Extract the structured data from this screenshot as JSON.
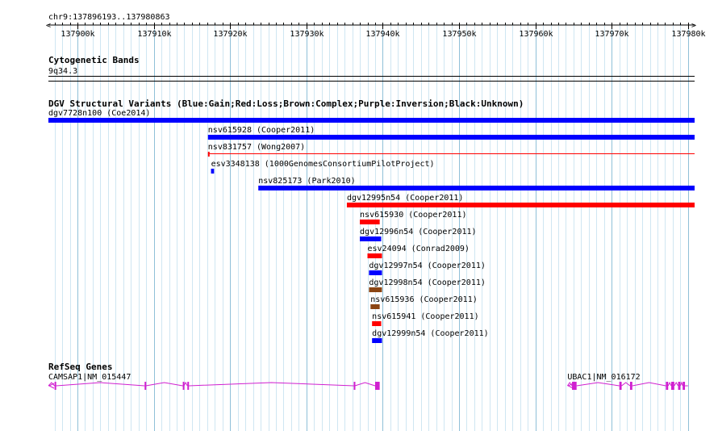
{
  "ruler": {
    "region": "chr9:137896193..137980863",
    "start": 137896193,
    "end": 137980863,
    "ticks": [
      {
        "pos": 137900000,
        "label": "137900k"
      },
      {
        "pos": 137910000,
        "label": "137910k"
      },
      {
        "pos": 137920000,
        "label": "137920k"
      },
      {
        "pos": 137930000,
        "label": "137930k"
      },
      {
        "pos": 137940000,
        "label": "137940k"
      },
      {
        "pos": 137950000,
        "label": "137950k"
      },
      {
        "pos": 137960000,
        "label": "137960k"
      },
      {
        "pos": 137970000,
        "label": "137970k"
      },
      {
        "pos": 137980000,
        "label": "137980k"
      }
    ]
  },
  "cytobands": {
    "title": "Cytogenetic Bands",
    "band": "9q34.3"
  },
  "dgv": {
    "title": "DGV Structural Variants (Blue:Gain;Red:Loss;Brown:Complex;Purple:Inversion;Black:Unknown)",
    "colors": {
      "gain": "#0000ff",
      "loss": "#ff0000",
      "complex": "#8b4513"
    },
    "variants": [
      {
        "label": "dgv7728n100 (Coe2014)",
        "start": 137896193,
        "end": 137980863,
        "type": "gain",
        "style": "bar"
      },
      {
        "label": "nsv615928 (Cooper2011)",
        "start": 137917100,
        "end": 137980863,
        "type": "gain",
        "style": "bar"
      },
      {
        "label": "nsv831757 (Wong2007)",
        "start": 137917100,
        "end": 137980863,
        "type": "loss",
        "style": "line"
      },
      {
        "label": "esv3348138 (1000GenomesConsortiumPilotProject)",
        "start": 137917500,
        "end": 137917900,
        "type": "gain",
        "style": "bar"
      },
      {
        "label": "nsv825173 (Park2010)",
        "start": 137923700,
        "end": 137980863,
        "type": "gain",
        "style": "bar"
      },
      {
        "label": "dgv12995n54 (Cooper2011)",
        "start": 137935300,
        "end": 137980863,
        "type": "loss",
        "style": "bar"
      },
      {
        "label": "nsv615930 (Cooper2011)",
        "start": 137937000,
        "end": 137939600,
        "type": "loss",
        "style": "bar"
      },
      {
        "label": "dgv12996n54 (Cooper2011)",
        "start": 137937000,
        "end": 137939800,
        "type": "gain",
        "style": "bar"
      },
      {
        "label": "esv24094 (Conrad2009)",
        "start": 137938000,
        "end": 137939900,
        "type": "loss",
        "style": "bar"
      },
      {
        "label": "dgv12997n54 (Cooper2011)",
        "start": 137938200,
        "end": 137939900,
        "type": "gain",
        "style": "bar"
      },
      {
        "label": "dgv12998n54 (Cooper2011)",
        "start": 137938200,
        "end": 137939900,
        "type": "complex",
        "style": "bar"
      },
      {
        "label": "nsv615936 (Cooper2011)",
        "start": 137938400,
        "end": 137939600,
        "type": "complex",
        "style": "bar"
      },
      {
        "label": "nsv615941 (Cooper2011)",
        "start": 137938600,
        "end": 137939800,
        "type": "loss",
        "style": "bar"
      },
      {
        "label": "dgv12999n54 (Cooper2011)",
        "start": 137938600,
        "end": 137939900,
        "type": "gain",
        "style": "bar"
      }
    ]
  },
  "refseq": {
    "title": "RefSeq Genes",
    "color": "#d020d0",
    "genes": [
      {
        "label": "CAMSAP1|NM_015447",
        "start": 137896193,
        "end": 137939600,
        "exons": [
          [
            137897000,
            137897200
          ],
          [
            137908800,
            137908950
          ],
          [
            137913800,
            137913950
          ],
          [
            137914400,
            137914600
          ],
          [
            137936200,
            137936350
          ],
          [
            137939000,
            137939600
          ]
        ]
      },
      {
        "label": "UBAC1|NM_016172",
        "start": 137964200,
        "end": 137980000,
        "exons": [
          [
            137964800,
            137965400
          ],
          [
            137971000,
            137971300
          ],
          [
            137972400,
            137972700
          ],
          [
            137977100,
            137977400
          ],
          [
            137977800,
            137978200
          ],
          [
            137978700,
            137979000
          ],
          [
            137979300,
            137979600
          ]
        ]
      }
    ]
  }
}
